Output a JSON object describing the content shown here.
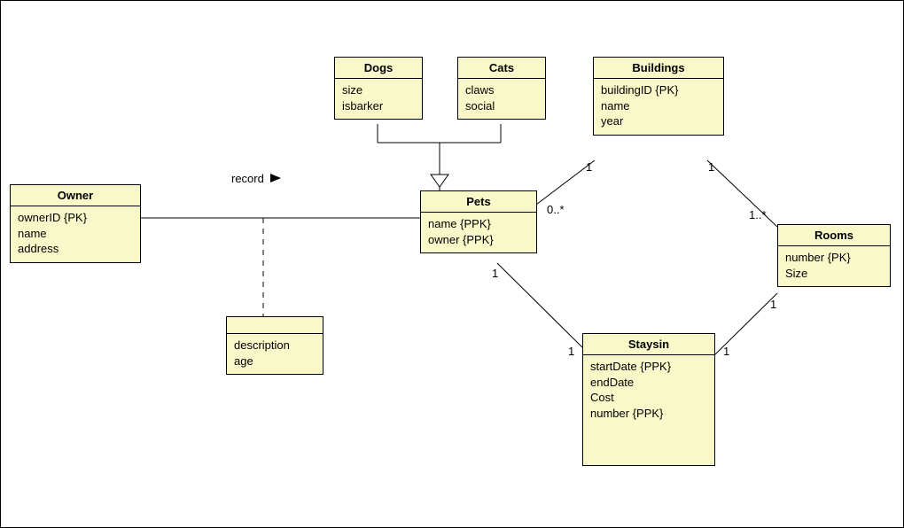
{
  "diagram": {
    "association_label": "record",
    "owner": {
      "title": "Owner",
      "attrs": [
        "ownerID {PK}",
        "name",
        "address"
      ]
    },
    "dogs": {
      "title": "Dogs",
      "attrs": [
        "size",
        "isbarker"
      ]
    },
    "cats": {
      "title": "Cats",
      "attrs": [
        "claws",
        "social"
      ]
    },
    "pets": {
      "title": "Pets",
      "attrs": [
        "name {PPK}",
        "owner {PPK}"
      ]
    },
    "buildings": {
      "title": "Buildings",
      "attrs": [
        "buildingID {PK}",
        "name",
        "year"
      ]
    },
    "rooms": {
      "title": "Rooms",
      "attrs": [
        "number {PK}",
        "Size"
      ]
    },
    "staysin": {
      "title": "Staysin",
      "attrs": [
        "startDate {PPK}",
        "endDate",
        "Cost",
        "number {PPK}"
      ]
    },
    "assoc": {
      "title": "",
      "attrs": [
        "description",
        "age"
      ]
    },
    "multiplicities": {
      "pets_buildings_near_pets": "0..*",
      "pets_buildings_near_buildings": "1",
      "buildings_rooms_near_buildings": "1",
      "buildings_rooms_near_rooms": "1..*",
      "rooms_staysin_near_rooms": "1",
      "rooms_staysin_near_staysin": "1",
      "pets_staysin_near_pets": "1",
      "pets_staysin_near_staysin": "1"
    }
  }
}
